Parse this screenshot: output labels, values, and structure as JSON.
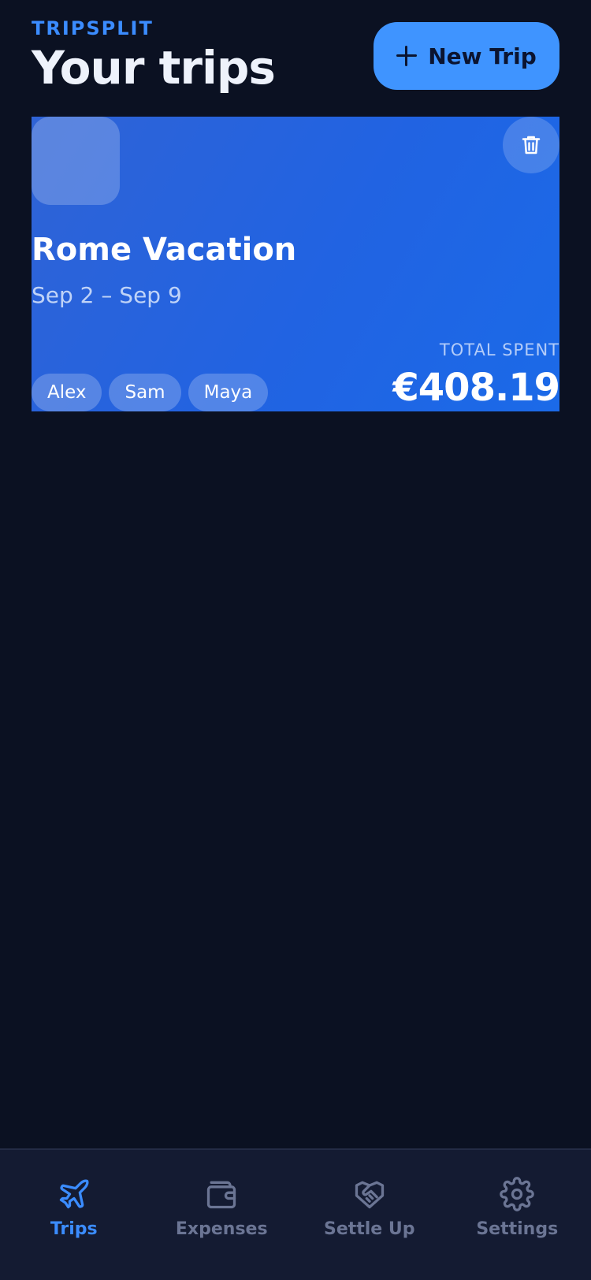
{
  "header": {
    "brand": "TRIPSPLIT",
    "title": "Your trips",
    "new_trip_label": "New Trip"
  },
  "trips": [
    {
      "name": "Rome Vacation",
      "dates": "Sep 2 – Sep 9",
      "members": [
        "Alex",
        "Sam",
        "Maya"
      ],
      "total_label": "TOTAL SPENT",
      "total_amount": "€408.19"
    }
  ],
  "tabs": [
    {
      "label": "Trips",
      "icon": "airplane-icon",
      "active": true
    },
    {
      "label": "Expenses",
      "icon": "wallet-icon",
      "active": false
    },
    {
      "label": "Settle Up",
      "icon": "handshake-icon",
      "active": false
    },
    {
      "label": "Settings",
      "icon": "gear-icon",
      "active": false
    }
  ],
  "colors": {
    "background": "#0b1122",
    "accent": "#3f94ff",
    "card": "#2163e2",
    "tab_bar": "#141b32",
    "tab_inactive": "#6b7594"
  }
}
